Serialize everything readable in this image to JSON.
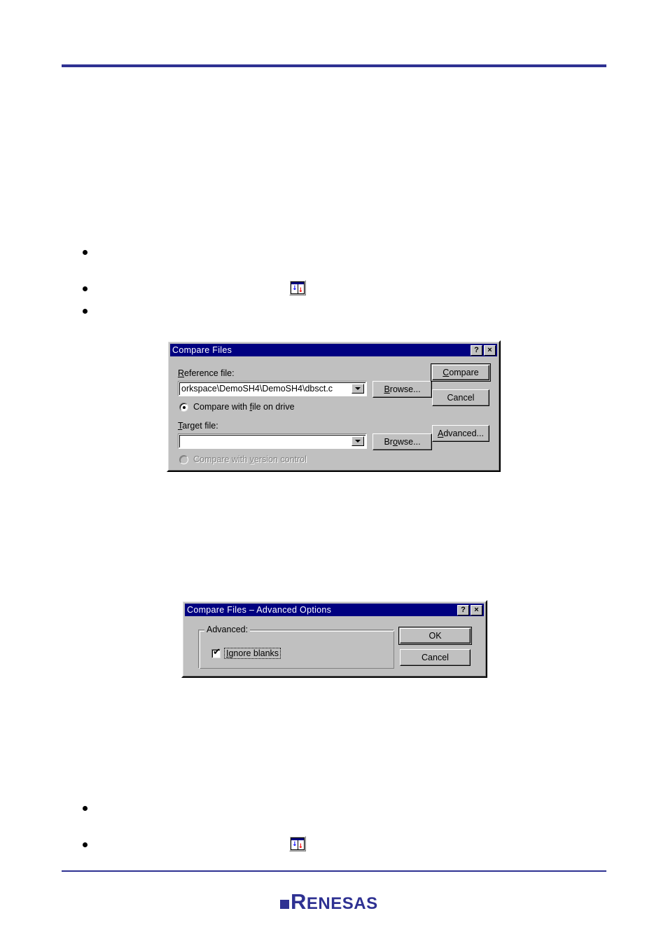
{
  "page": {
    "header_rule_color": "#2e3192",
    "footer_rule_color": "#2e3192"
  },
  "logo": {
    "text_full": "RENESAS",
    "r": "R",
    "rest": "ENESAS"
  },
  "bullets": {
    "group_top": [
      {
        "text": ""
      },
      {
        "text": "",
        "icon": "compare-files-toolbar-icon"
      },
      {
        "text": ""
      }
    ],
    "group_bottom": [
      {
        "text": ""
      },
      {
        "text": "",
        "icon": "compare-files-toolbar-icon"
      }
    ]
  },
  "toolbar_icon": {
    "name": "compare-files-toolbar-icon",
    "left_glyph": "↓",
    "right_glyph": "↓",
    "left_color": "#0000ff",
    "right_color": "#ff0000",
    "titlebar_color": "#000080"
  },
  "dialog_compare_files": {
    "title": "Compare Files",
    "titlebar_color": "#000080",
    "help_button": "?",
    "close_button": "×",
    "reference_label_pre": "R",
    "reference_label_post": "eference file:",
    "reference_value": "orkspace\\DemoSH4\\DemoSH4\\dbsct.c",
    "radio_file_pre": "Compare with ",
    "radio_file_accel": "f",
    "radio_file_post": "ile on drive",
    "radio_file_selected": true,
    "target_label_pre": "T",
    "target_label_post": "arget file:",
    "target_value": "",
    "radio_version_pre": "Compare with ",
    "radio_version_accel": "v",
    "radio_version_post": "ersion control",
    "radio_version_enabled": false,
    "browse1_pre": "B",
    "browse1_accel": "",
    "browse1_post": "rowse...",
    "browse2_a": "Br",
    "browse2_accel": "o",
    "browse2_post": "wse...",
    "compare_pre": "",
    "compare_accel": "C",
    "compare_post": "ompare",
    "cancel_label": "Cancel",
    "advanced_pre": "",
    "advanced_accel": "A",
    "advanced_post": "dvanced..."
  },
  "dialog_advanced_options": {
    "title": "Compare Files – Advanced Options",
    "titlebar_color": "#000080",
    "help_button": "?",
    "close_button": "×",
    "group_title": "Advanced:",
    "checkbox_accel": "I",
    "checkbox_post": "gnore blanks",
    "checkbox_checked": true,
    "checkmark": "✔",
    "ok_label": "OK",
    "cancel_label": "Cancel"
  }
}
